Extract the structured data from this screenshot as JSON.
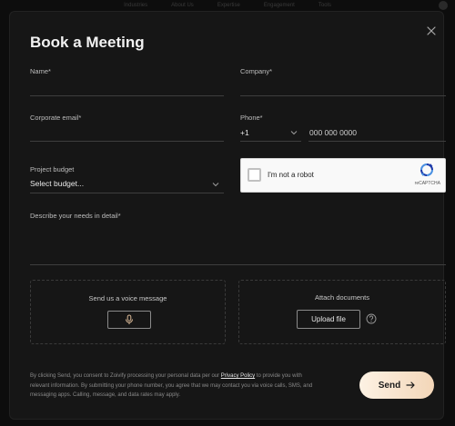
{
  "backdrop": {
    "nav_items": [
      "Industries",
      "About Us",
      "Expertise",
      "Engagement",
      "Tools"
    ]
  },
  "modal": {
    "title": "Book a Meeting",
    "close_icon": "close-icon"
  },
  "form": {
    "name_label": "Name*",
    "company_label": "Company*",
    "email_label": "Corporate email*",
    "phone_label": "Phone*",
    "phone_code": "+1",
    "phone_placeholder": "000 000 0000",
    "budget_label": "Project budget",
    "budget_value": "Select budget...",
    "needs_label": "Describe your needs in detail*"
  },
  "recaptcha": {
    "label": "I'm not a robot",
    "brand": "reCAPTCHA"
  },
  "voice": {
    "caption": "Send us a voice message",
    "icon": "microphone-icon"
  },
  "attach": {
    "caption": "Attach documents",
    "upload_label": "Upload file",
    "help_icon": "question-circle-icon"
  },
  "legal": {
    "text_before": "By clicking Send, you consent to Zoivify processing your personal data per our ",
    "link": "Privacy Policy",
    "text_after": " to provide you with relevant information. By submitting your phone number, you agree that we may contact you via voice calls, SMS, and messaging apps. Calling, message, and data rates may apply."
  },
  "send": {
    "label": "Send",
    "icon": "arrow-right-icon"
  },
  "colors": {
    "background": "#0d0d0d",
    "modal": "#161616",
    "send_gradient_start": "#fdf2e4",
    "send_gradient_end": "#f3d6b8"
  }
}
